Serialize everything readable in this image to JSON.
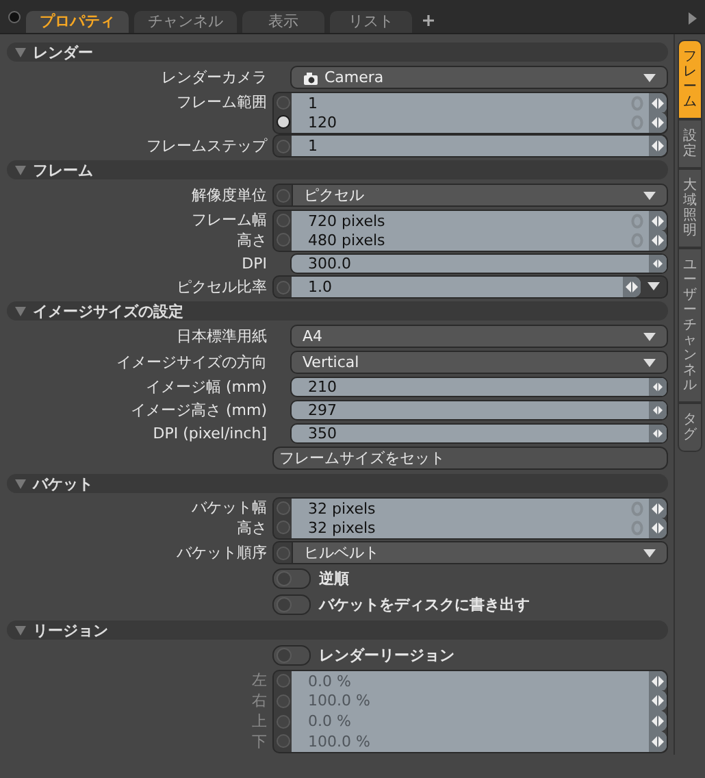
{
  "tabs": [
    {
      "label": "プロパティ",
      "selected": true
    },
    {
      "label": "チャンネル",
      "selected": false
    },
    {
      "label": "表示",
      "selected": false
    },
    {
      "label": "リスト",
      "selected": false
    }
  ],
  "side_tabs": [
    {
      "label": "フレーム",
      "selected": true
    },
    {
      "label": "設定",
      "selected": false
    },
    {
      "label": "大域照明",
      "selected": false
    },
    {
      "label": "ユーザーチャンネル",
      "selected": false
    },
    {
      "label": "タグ",
      "selected": false
    }
  ],
  "sections": [
    {
      "title": "レンダー",
      "expanded": true,
      "rows": [
        {
          "kind": "item-select",
          "label": "レンダーカメラ",
          "value": "Camera"
        },
        {
          "kind": "number",
          "animatable": true,
          "linked": true,
          "lines": [
            {
              "label": "フレーム範囲",
              "value": "1",
              "keyed": false
            },
            {
              "value": "120",
              "keyed": true
            }
          ]
        },
        {
          "kind": "number",
          "animatable": true,
          "linked": false,
          "lines": [
            {
              "label": "フレームステップ",
              "value": "1",
              "keyed": false
            }
          ]
        }
      ]
    },
    {
      "title": "フレーム",
      "expanded": true,
      "rows": [
        {
          "kind": "dropdown",
          "animatable": true,
          "label": "解像度単位",
          "value": "ピクセル"
        },
        {
          "kind": "number",
          "animatable": true,
          "linked": true,
          "lines": [
            {
              "label": "フレーム幅",
              "value": "720 pixels",
              "keyed": false
            },
            {
              "label": "高さ",
              "value": "480 pixels",
              "keyed": false
            }
          ]
        },
        {
          "kind": "number",
          "animatable": false,
          "linked": false,
          "lines": [
            {
              "label": "DPI",
              "value": "300.0"
            }
          ]
        },
        {
          "kind": "number",
          "animatable": true,
          "linked": false,
          "presets": true,
          "lines": [
            {
              "label": "ピクセル比率",
              "value": "1.0",
              "keyed": false
            }
          ]
        }
      ]
    },
    {
      "title": "イメージサイズの設定",
      "expanded": true,
      "rows": [
        {
          "kind": "dropdown",
          "animatable": false,
          "label": "日本標準用紙",
          "value": "A4"
        },
        {
          "kind": "dropdown",
          "animatable": false,
          "label": "イメージサイズの方向",
          "value": "Vertical"
        },
        {
          "kind": "number",
          "animatable": false,
          "linked": false,
          "lines": [
            {
              "label": "イメージ幅 (mm)",
              "value": "210"
            }
          ]
        },
        {
          "kind": "number",
          "animatable": false,
          "linked": false,
          "lines": [
            {
              "label": "イメージ高さ (mm)",
              "value": "297"
            }
          ]
        },
        {
          "kind": "number",
          "animatable": false,
          "linked": false,
          "lines": [
            {
              "label": "DPI (pixel/inch]",
              "value": "350"
            }
          ]
        },
        {
          "kind": "button",
          "label": "フレームサイズをセット"
        }
      ]
    },
    {
      "title": "バケット",
      "expanded": true,
      "rows": [
        {
          "kind": "number",
          "animatable": true,
          "linked": true,
          "lines": [
            {
              "label": "バケット幅",
              "value": "32 pixels",
              "keyed": false
            },
            {
              "label": "高さ",
              "value": "32 pixels",
              "keyed": false
            }
          ]
        },
        {
          "kind": "dropdown",
          "animatable": true,
          "label": "バケット順序",
          "value": "ヒルベルト"
        },
        {
          "kind": "toggle",
          "label": "逆順",
          "on": false
        },
        {
          "kind": "toggle",
          "label": "バケットをディスクに書き出す",
          "on": false
        }
      ]
    },
    {
      "title": "リージョン",
      "expanded": true,
      "rows": [
        {
          "kind": "toggle",
          "label": "レンダーリージョン",
          "on": false
        },
        {
          "kind": "number",
          "animatable": true,
          "linked": false,
          "disabled": true,
          "lines": [
            {
              "label": "左",
              "value": "0.0 %",
              "keyed": false
            },
            {
              "label": "右",
              "value": "100.0 %",
              "keyed": false
            },
            {
              "label": "上",
              "value": "0.0 %",
              "keyed": false
            },
            {
              "label": "下",
              "value": "100.0 %",
              "keyed": false
            }
          ]
        }
      ]
    }
  ]
}
